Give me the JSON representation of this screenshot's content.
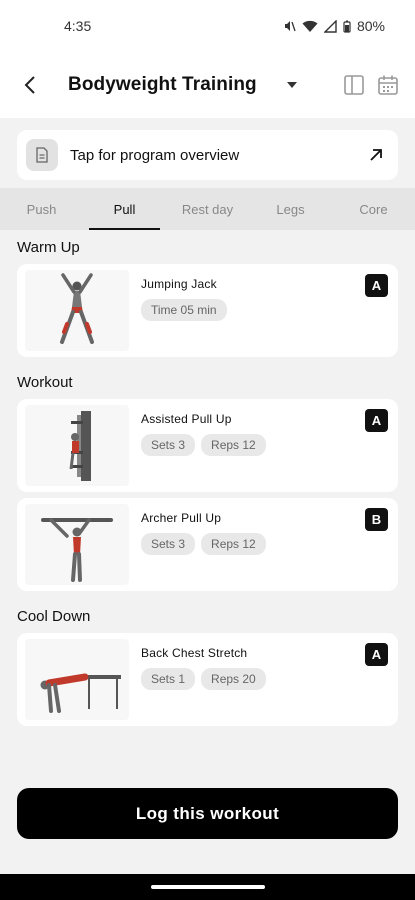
{
  "status": {
    "time": "4:35",
    "battery": "80%"
  },
  "header": {
    "title": "Bodyweight Training"
  },
  "overview": {
    "label": "Tap for program overview"
  },
  "tabs": [
    {
      "label": "Push"
    },
    {
      "label": "Pull",
      "active": true
    },
    {
      "label": "Rest day"
    },
    {
      "label": "Legs"
    },
    {
      "label": "Core"
    }
  ],
  "sections": {
    "warmup": {
      "title": "Warm Up",
      "items": [
        {
          "name": "Jumping Jack",
          "chips": [
            "Time 05 min"
          ],
          "badge": "A"
        }
      ]
    },
    "workout": {
      "title": "Workout",
      "items": [
        {
          "name": "Assisted Pull Up",
          "chips": [
            "Sets 3",
            "Reps 12"
          ],
          "badge": "A"
        },
        {
          "name": "Archer Pull Up",
          "chips": [
            "Sets 3",
            "Reps 12"
          ],
          "badge": "B"
        }
      ]
    },
    "cooldown": {
      "title": "Cool Down",
      "items": [
        {
          "name": "Back Chest Stretch",
          "chips": [
            "Sets 1",
            "Reps 20"
          ],
          "badge": "A"
        }
      ]
    }
  },
  "footer": {
    "log_label": "Log this workout"
  }
}
